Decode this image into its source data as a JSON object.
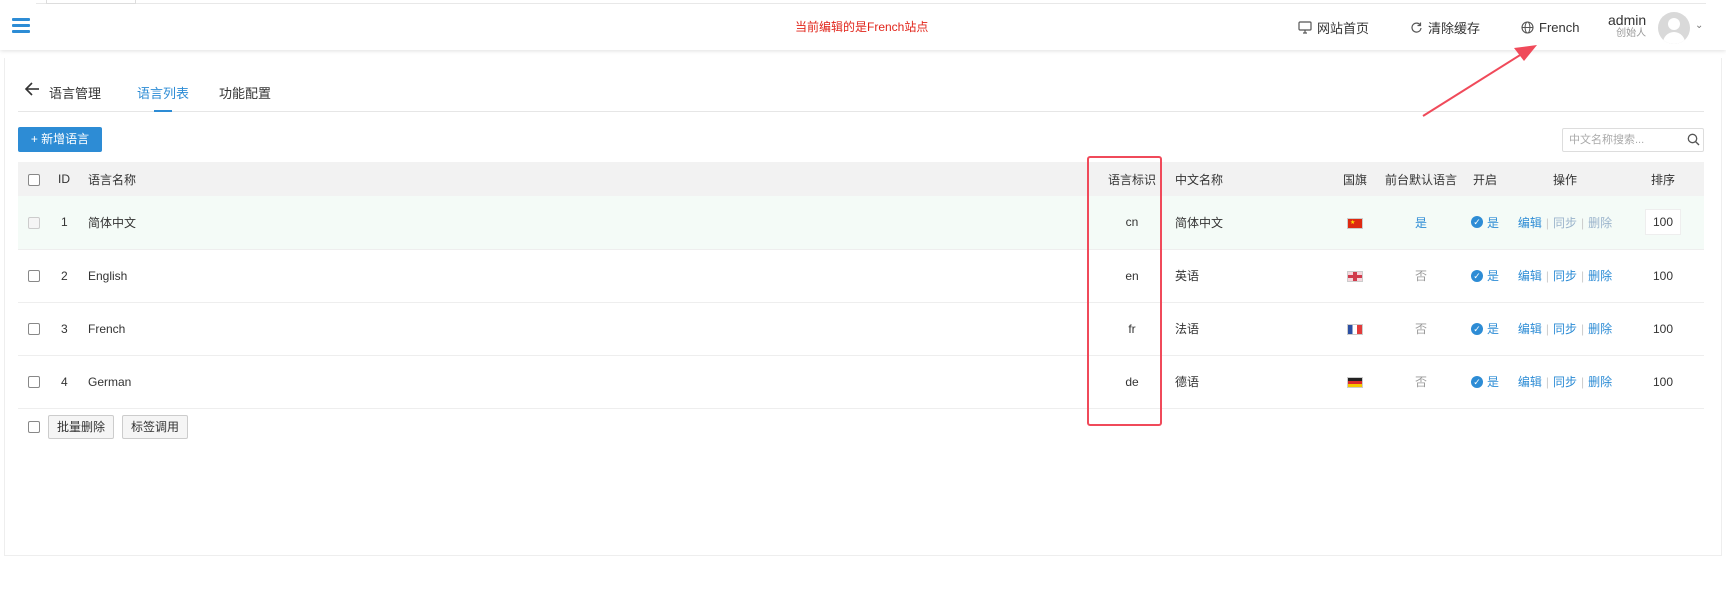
{
  "header": {
    "notice": "当前编辑的是French站点",
    "links": [
      {
        "label": "网站首页",
        "icon": "monitor-icon"
      },
      {
        "label": "清除缓存",
        "icon": "refresh-icon"
      },
      {
        "label": "French",
        "icon": "globe-icon"
      }
    ],
    "user": {
      "name": "admin",
      "role": "创始人"
    }
  },
  "tabs": {
    "title": "语言管理",
    "items": [
      {
        "label": "语言列表",
        "active": true
      },
      {
        "label": "功能配置",
        "active": false
      }
    ]
  },
  "toolbar": {
    "add_label": "+ 新增语言",
    "search_placeholder": "中文名称搜索..."
  },
  "table": {
    "columns": [
      "ID",
      "语言名称",
      "语言标识",
      "中文名称",
      "国旗",
      "前台默认语言",
      "开启",
      "操作",
      "排序"
    ],
    "rows": [
      {
        "id": "1",
        "name": "简体中文",
        "code": "cn",
        "cn_name": "简体中文",
        "flag": "china",
        "default": "是",
        "enabled": "是",
        "actions": [
          "编辑",
          "同步",
          "删除"
        ],
        "sort": "100"
      },
      {
        "id": "2",
        "name": "English",
        "code": "en",
        "cn_name": "英语",
        "flag": "uk",
        "default": "否",
        "enabled": "是",
        "actions": [
          "编辑",
          "同步",
          "删除"
        ],
        "sort": "100"
      },
      {
        "id": "3",
        "name": "French",
        "code": "fr",
        "cn_name": "法语",
        "flag": "france",
        "default": "否",
        "enabled": "是",
        "actions": [
          "编辑",
          "同步",
          "删除"
        ],
        "sort": "100"
      },
      {
        "id": "4",
        "name": "German",
        "code": "de",
        "cn_name": "德语",
        "flag": "germany",
        "default": "否",
        "enabled": "是",
        "actions": [
          "编辑",
          "同步",
          "删除"
        ],
        "sort": "100"
      }
    ]
  },
  "bulk": {
    "delete_label": "批量删除",
    "tag_label": "标签调用"
  },
  "colors": {
    "accent": "#2d8cd5",
    "notice": "#e1251b",
    "highlight": "#f04a5a"
  }
}
